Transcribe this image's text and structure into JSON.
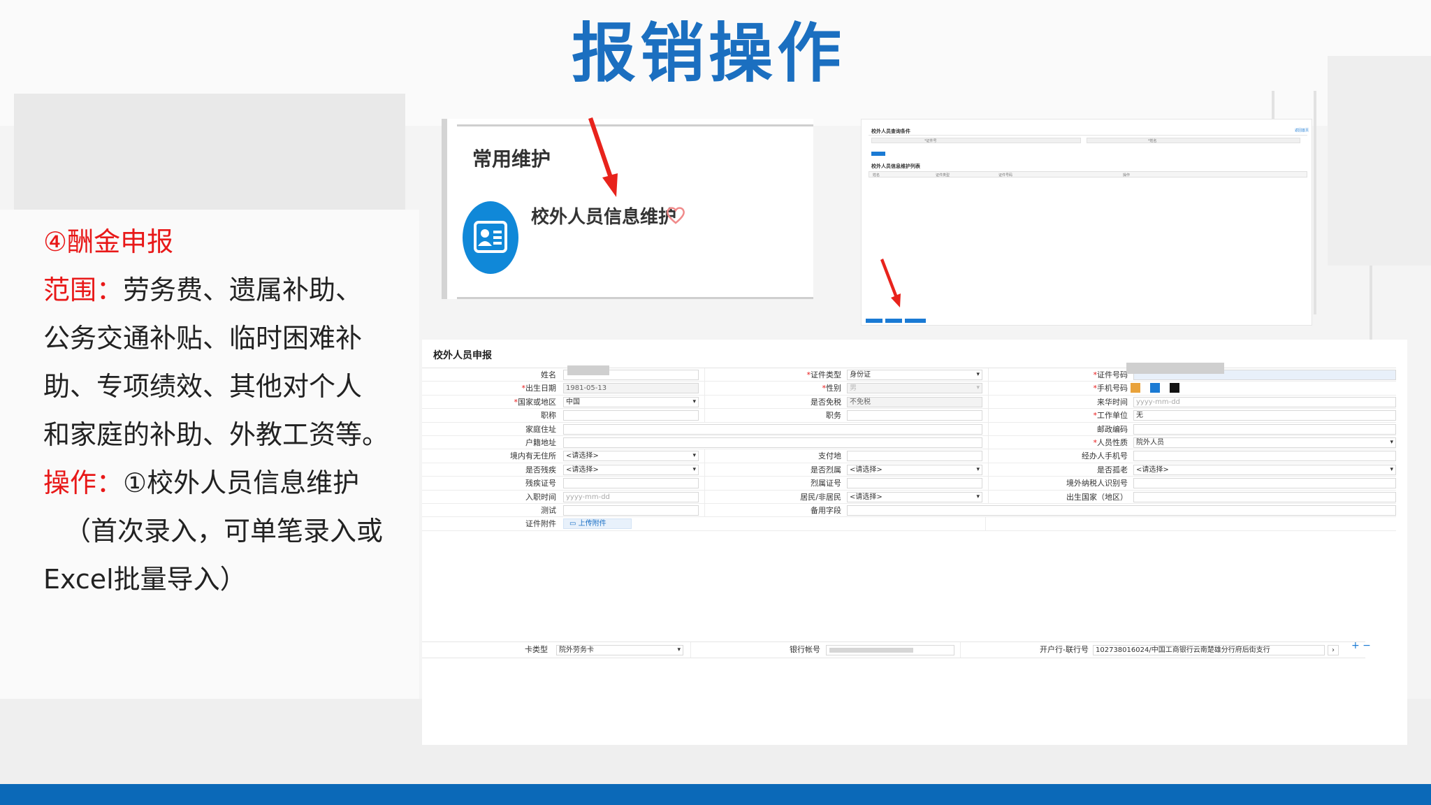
{
  "slide": {
    "title": "报销操作"
  },
  "left_panel": {
    "heading": "④酬金申报",
    "scope_label": "范围：",
    "scope_text_1": "劳务费、遗属补助、",
    "scope_text_2": "公务交通补贴、临时困难补",
    "scope_text_3": "助、专项绩效、其他对个人",
    "scope_text_4": "和家庭的补助、外教工资等。",
    "op_label": "操作：",
    "op_text_1": "①校外人员信息维护",
    "op_text_2": "（首次录入，可单笔录入或",
    "op_text_3": "Excel批量导入）"
  },
  "shot1": {
    "section_title": "常用维护",
    "app_label": "校外人员信息维护"
  },
  "shot2": {
    "query_title": "校外人员查询条件",
    "top_link": "返回首页",
    "field_id": "*证件号",
    "field_name": "*姓名",
    "list_title": "校外人员信息维护列表",
    "col1": "姓名",
    "col2": "证件类型",
    "col3": "证件号码",
    "col4": "操作"
  },
  "form": {
    "title": "校外人员申报",
    "rows": {
      "r1": {
        "l1": "姓名",
        "l2": "证件类型",
        "v2": "身份证",
        "l3": "证件号码"
      },
      "r2": {
        "l1": "出生日期",
        "v1": "1981-05-13",
        "l2": "性别",
        "v2": "男",
        "l3": "手机号码"
      },
      "r3": {
        "l1": "国家或地区",
        "v1": "中国",
        "l2": "是否免税",
        "v2": "不免税",
        "l3": "来华时间",
        "v3": "yyyy-mm-dd"
      },
      "r4": {
        "l1": "职称",
        "l2": "职务",
        "l3": "工作单位",
        "v3": "无"
      },
      "r5": {
        "l1": "家庭住址",
        "l3": "邮政编码"
      },
      "r6": {
        "l1": "户籍地址",
        "l3": "人员性质",
        "v3": "院外人员"
      },
      "r7": {
        "l1": "境内有无住所",
        "v1": "<请选择>",
        "l2": "支付地",
        "l3": "经办人手机号"
      },
      "r8": {
        "l1": "是否残疾",
        "v1": "<请选择>",
        "l2": "是否烈属",
        "v2": "<请选择>",
        "l3": "是否孤老",
        "v3": "<请选择>"
      },
      "r9": {
        "l1": "残疾证号",
        "l2": "烈属证号",
        "l3": "境外纳税人识别号"
      },
      "r10": {
        "l1": "入职时间",
        "v1": "yyyy-mm-dd",
        "l2": "居民/非居民",
        "v2": "<请选择>",
        "l3": "出生国家（地区）"
      },
      "r11": {
        "l1": "测试",
        "l2": "备用字段"
      },
      "r12": {
        "l1": "证件附件",
        "upload": "上传附件"
      }
    },
    "bank": {
      "card_type_label": "卡类型",
      "card_type_value": "院外劳务卡",
      "account_label": "银行帐号",
      "branch_label": "开户行-联行号",
      "branch_value": "102738016024/中国工商银行云南楚雄分行府后街支行",
      "add_remove": "+ −"
    }
  },
  "colors": {
    "title_blue": "#1b6fc0",
    "accent_red": "#e81818",
    "bottom_bar": "#0b69b8",
    "icon_blue": "#1088d8"
  }
}
